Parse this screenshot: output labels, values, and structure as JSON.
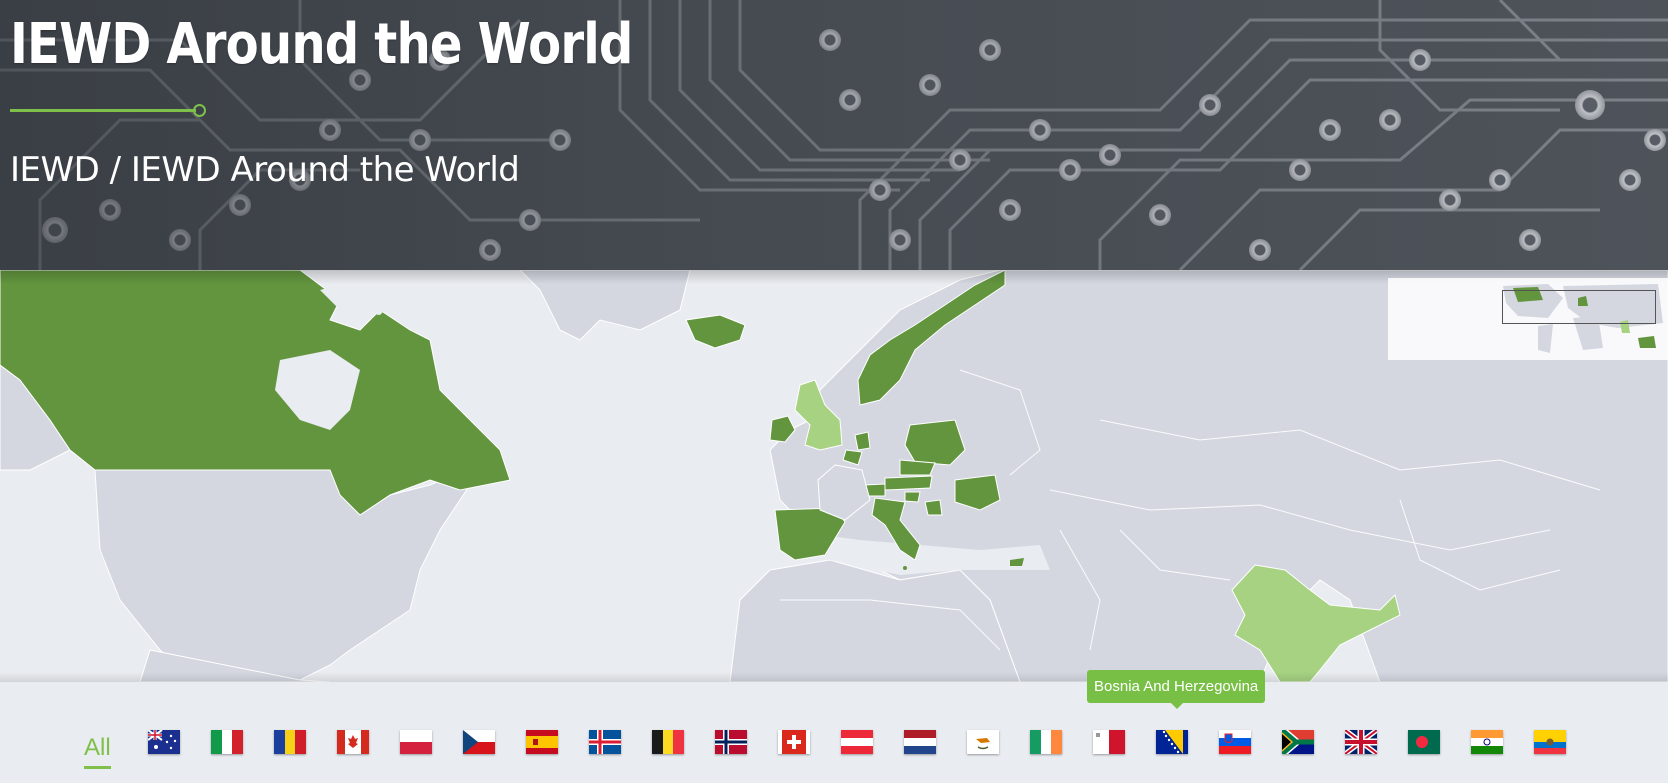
{
  "header": {
    "title": "IEWD Around the World",
    "breadcrumb": {
      "root": "IEWD",
      "separator": "/",
      "current": "IEWD Around the World"
    }
  },
  "colors": {
    "accent": "#7ec04a",
    "member_country": "#62953e",
    "hover_country": "#a6d282",
    "other_country": "#d4d7e0",
    "ocean": "#e9ecf0"
  },
  "map": {
    "highlighted_countries": [
      "Canada",
      "Iceland",
      "Norway",
      "Ireland",
      "Belgium",
      "Netherlands",
      "Poland",
      "Czech Republic",
      "Austria",
      "Switzerland",
      "Italy",
      "Spain",
      "Romania",
      "Slovenia",
      "Bosnia And Herzegovina",
      "Malta",
      "Cyprus"
    ],
    "light_highlighted_countries": [
      "United Kingdom",
      "India"
    ]
  },
  "filter": {
    "all_label": "All",
    "hover_tooltip": "Bosnia And Herzegovina",
    "flags": [
      {
        "country": "Australia",
        "icon": "flag-australia-icon"
      },
      {
        "country": "Italy",
        "icon": "flag-italy-icon"
      },
      {
        "country": "Romania",
        "icon": "flag-romania-icon"
      },
      {
        "country": "Canada",
        "icon": "flag-canada-icon"
      },
      {
        "country": "Poland",
        "icon": "flag-poland-icon"
      },
      {
        "country": "Czech Republic",
        "icon": "flag-czech-republic-icon"
      },
      {
        "country": "Spain",
        "icon": "flag-spain-icon"
      },
      {
        "country": "Iceland",
        "icon": "flag-iceland-icon"
      },
      {
        "country": "Belgium",
        "icon": "flag-belgium-icon"
      },
      {
        "country": "Norway",
        "icon": "flag-norway-icon"
      },
      {
        "country": "Switzerland",
        "icon": "flag-switzerland-icon"
      },
      {
        "country": "Austria",
        "icon": "flag-austria-icon"
      },
      {
        "country": "Netherlands",
        "icon": "flag-netherlands-icon"
      },
      {
        "country": "Cyprus",
        "icon": "flag-cyprus-icon"
      },
      {
        "country": "Ireland",
        "icon": "flag-ireland-icon"
      },
      {
        "country": "Malta",
        "icon": "flag-malta-icon"
      },
      {
        "country": "Bosnia And Herzegovina",
        "icon": "flag-bosnia-icon"
      },
      {
        "country": "Slovenia",
        "icon": "flag-slovenia-icon"
      },
      {
        "country": "South Africa",
        "icon": "flag-south-africa-icon"
      },
      {
        "country": "United Kingdom",
        "icon": "flag-united-kingdom-icon"
      },
      {
        "country": "Bangladesh",
        "icon": "flag-bangladesh-icon"
      },
      {
        "country": "India",
        "icon": "flag-india-icon"
      },
      {
        "country": "Ecuador",
        "icon": "flag-ecuador-icon"
      }
    ]
  }
}
